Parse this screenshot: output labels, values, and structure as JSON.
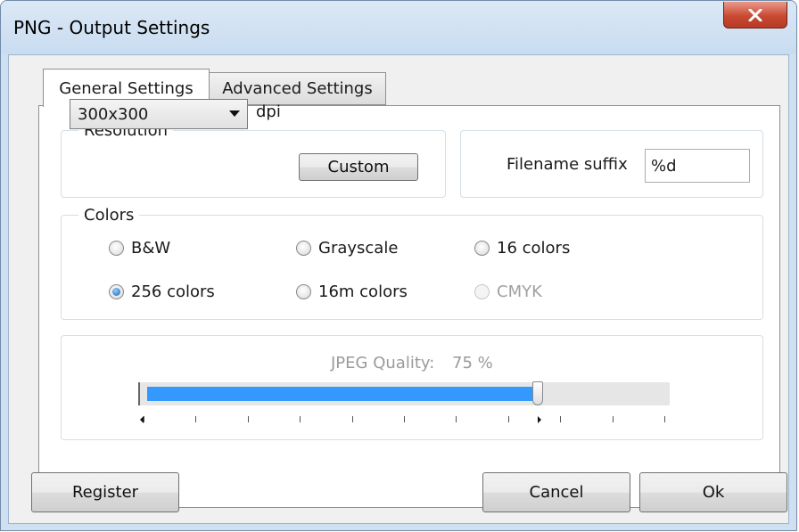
{
  "window": {
    "title": "PNG - Output Settings"
  },
  "tabs": [
    {
      "label": "General Settings",
      "active": true
    },
    {
      "label": "Advanced Settings",
      "active": false
    }
  ],
  "resolution": {
    "legend": "Resolution",
    "selected": "300x300",
    "unit": "dpi",
    "custom_label": "Custom"
  },
  "filename": {
    "label": "Filename suffix",
    "value": "%d"
  },
  "colors": {
    "legend": "Colors",
    "options": [
      {
        "label": "B&W",
        "checked": false,
        "enabled": true
      },
      {
        "label": "Grayscale",
        "checked": false,
        "enabled": true
      },
      {
        "label": "16 colors",
        "checked": false,
        "enabled": true
      },
      {
        "label": "256 colors",
        "checked": true,
        "enabled": true
      },
      {
        "label": "16m colors",
        "checked": false,
        "enabled": true
      },
      {
        "label": "CMYK",
        "checked": false,
        "enabled": false
      }
    ]
  },
  "jpeg": {
    "label": "JPEG Quality:",
    "value_text": "75 %",
    "value": 75,
    "enabled": false
  },
  "buttons": {
    "register": "Register",
    "cancel": "Cancel",
    "ok": "Ok"
  },
  "icons": {
    "close": "close-icon",
    "dropdown": "chevron-down-icon"
  }
}
